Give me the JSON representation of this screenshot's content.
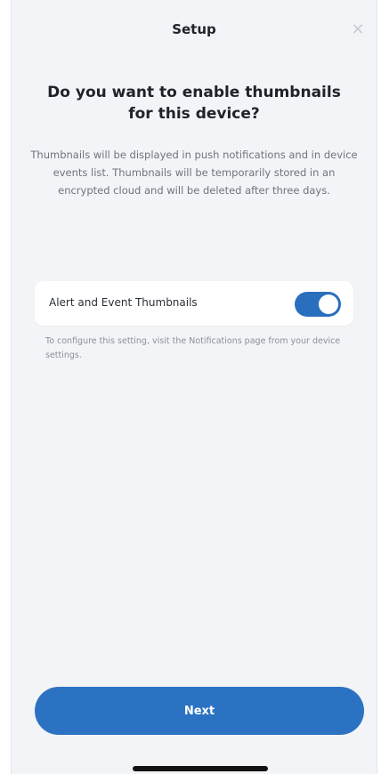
{
  "header": {
    "title": "Setup",
    "close_glyph": "×",
    "close_icon": "close-icon"
  },
  "main": {
    "heading": "Do you want to enable thumbnails for this device?",
    "description": "Thumbnails will be displayed in push notifications and in device events list. Thumbnails will be temporarily stored in an encrypted cloud and will be deleted after three days.",
    "toggle": {
      "label": "Alert and Event Thumbnails",
      "state": "on"
    },
    "hint": "To configure this setting, visit the Notifications page from your device settings."
  },
  "footer": {
    "next_label": "Next"
  },
  "colors": {
    "accent": "#2c72c2",
    "background": "#f2f4f7"
  }
}
